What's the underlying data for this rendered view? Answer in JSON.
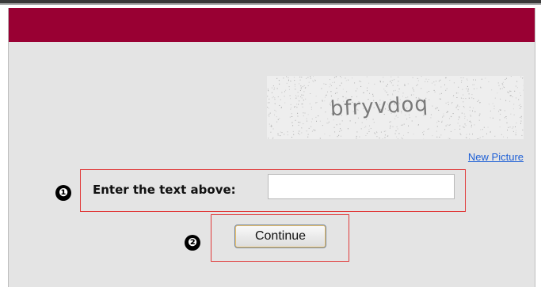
{
  "captcha": {
    "image_text": "bfryvdoq",
    "new_picture_label": "New Picture"
  },
  "form": {
    "prompt_label": "Enter the text above:",
    "input_value": "",
    "continue_label": "Continue"
  },
  "annotations": {
    "step_1": "❶",
    "step_2": "❷"
  },
  "colors": {
    "banner": "#990033",
    "panel_background": "#e4e4e4",
    "highlight": "#e03a3a",
    "link": "#1d5fd6"
  }
}
